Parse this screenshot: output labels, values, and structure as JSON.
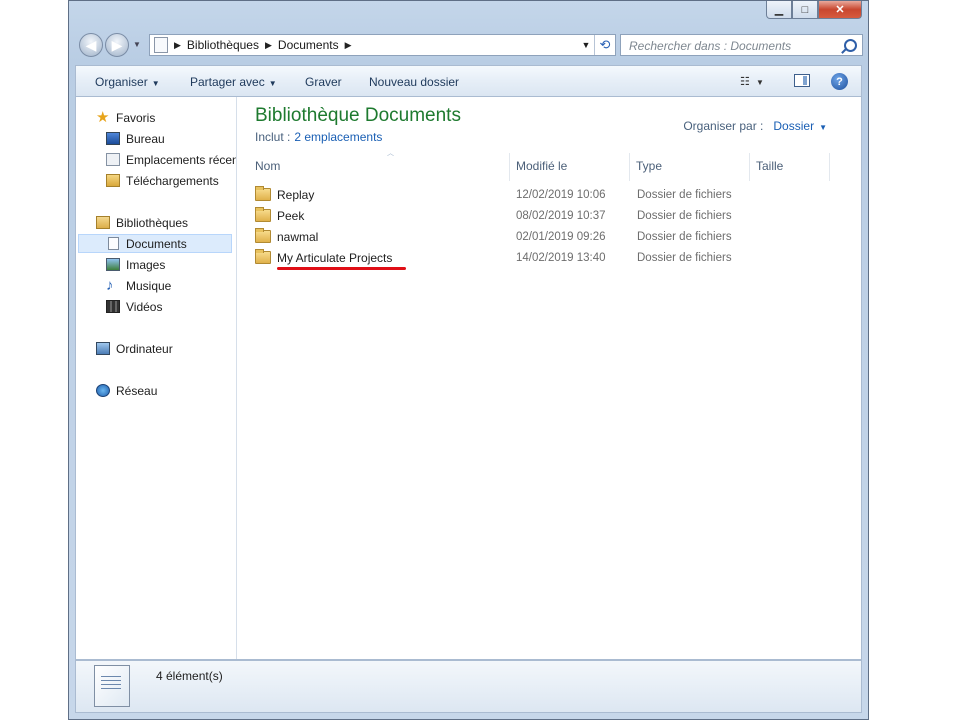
{
  "window": {
    "controls": {
      "minimize": "▁",
      "maximize": "□",
      "close": "✕"
    }
  },
  "nav": {
    "back_icon": "arrow-left-icon",
    "forward_icon": "arrow-right-icon",
    "breadcrumb": [
      "Bibliothèques",
      "Documents"
    ],
    "search_placeholder": "Rechercher dans : Documents"
  },
  "toolbar": {
    "organize": "Organiser",
    "share": "Partager avec",
    "burn": "Graver",
    "new_folder": "Nouveau dossier"
  },
  "sidebar": {
    "favorites": {
      "label": "Favoris",
      "items": [
        "Bureau",
        "Emplacements récents",
        "Téléchargements"
      ]
    },
    "libraries": {
      "label": "Bibliothèques",
      "items": [
        "Documents",
        "Images",
        "Musique",
        "Vidéos"
      ],
      "selected": "Documents"
    },
    "computer": "Ordinateur",
    "network": "Réseau"
  },
  "main": {
    "title": "Bibliothèque Documents",
    "includes_label": "Inclut :",
    "includes_link": "2 emplacements",
    "arrange_label": "Organiser par :",
    "arrange_value": "Dossier",
    "columns": [
      "Nom",
      "Modifié le",
      "Type",
      "Taille"
    ],
    "files": [
      {
        "name": "Replay",
        "modified": "12/02/2019 10:06",
        "type": "Dossier de fichiers"
      },
      {
        "name": "Peek",
        "modified": "08/02/2019 10:37",
        "type": "Dossier de fichiers"
      },
      {
        "name": "nawmal",
        "modified": "02/01/2019 09:26",
        "type": "Dossier de fichiers"
      },
      {
        "name": "My Articulate Projects",
        "modified": "14/02/2019 13:40",
        "type": "Dossier de fichiers"
      }
    ]
  },
  "status": {
    "count": "4 élément(s)"
  },
  "colors": {
    "title_green": "#1e7a2f",
    "link_blue": "#1a5fb4",
    "highlight_red": "#e00e16"
  }
}
